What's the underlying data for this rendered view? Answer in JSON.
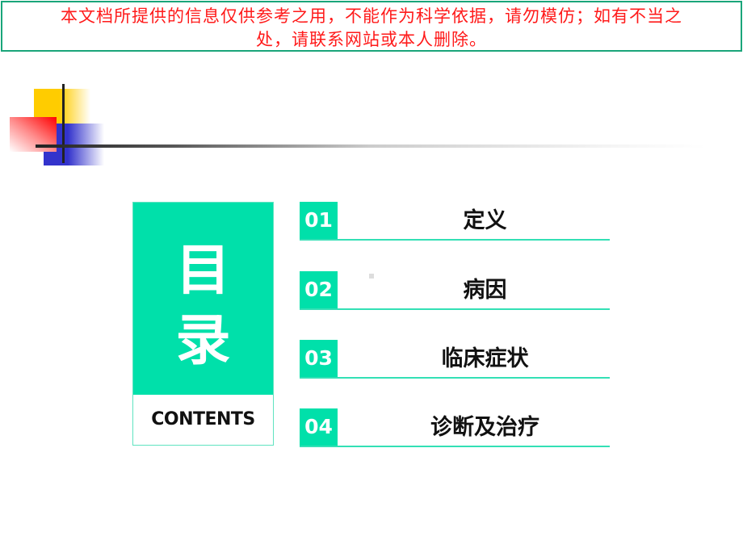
{
  "disclaimer": {
    "line1": "本文档所提供的信息仅供参考之用，不能作为科学依据，请勿模仿；如有不当之",
    "line2": "处，请联系网站或本人删除。",
    "text_color": "#ff1a1a",
    "border_color": "#1aa57a"
  },
  "logo": {
    "icon": "decorative-squares-logo",
    "colors": {
      "yellow": "#ffcc00",
      "blue": "#3333cc",
      "red": "#ff0000",
      "line": "#222222"
    }
  },
  "title_block": {
    "char1": "目",
    "char2": "录",
    "subtitle": "CONTENTS",
    "accent_color": "#00e0aa"
  },
  "toc": {
    "items": [
      {
        "number": "01",
        "label": "定义"
      },
      {
        "number": "02",
        "label": "病因"
      },
      {
        "number": "03",
        "label": "临床症状"
      },
      {
        "number": "04",
        "label": "诊断及治疗"
      }
    ]
  }
}
